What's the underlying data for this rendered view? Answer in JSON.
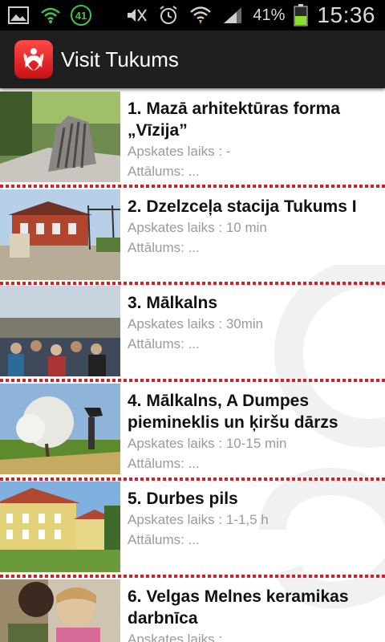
{
  "statusbar": {
    "battery": "41%",
    "time": "15:36",
    "notif_count": "41"
  },
  "app": {
    "title": "Visit Tukums",
    "accent": "#d61f26"
  },
  "items": [
    {
      "title": "1. Mazā arhitektūras forma „Vīzija”",
      "visit": "Apskates laiks : -",
      "distance": "Attālums: ..."
    },
    {
      "title": "2. Dzelzceļa stacija Tukums I",
      "visit": "Apskates laiks : 10 min",
      "distance": "Attālums: ..."
    },
    {
      "title": "3. Mālkalns",
      "visit": "Apskates laiks : 30min",
      "distance": "Attālums: ..."
    },
    {
      "title": "4. Mālkalns, A Dumpes piemineklis un ķiršu dārzs",
      "visit": "Apskates laiks : 10-15 min",
      "distance": "Attālums: ..."
    },
    {
      "title": "5. Durbes pils",
      "visit": "Apskates laiks : 1-1,5 h",
      "distance": "Attālums: ..."
    },
    {
      "title": "6. Velgas Melnes keramikas darbnīca",
      "visit": "Apskates laiks : ",
      "distance": ""
    }
  ]
}
